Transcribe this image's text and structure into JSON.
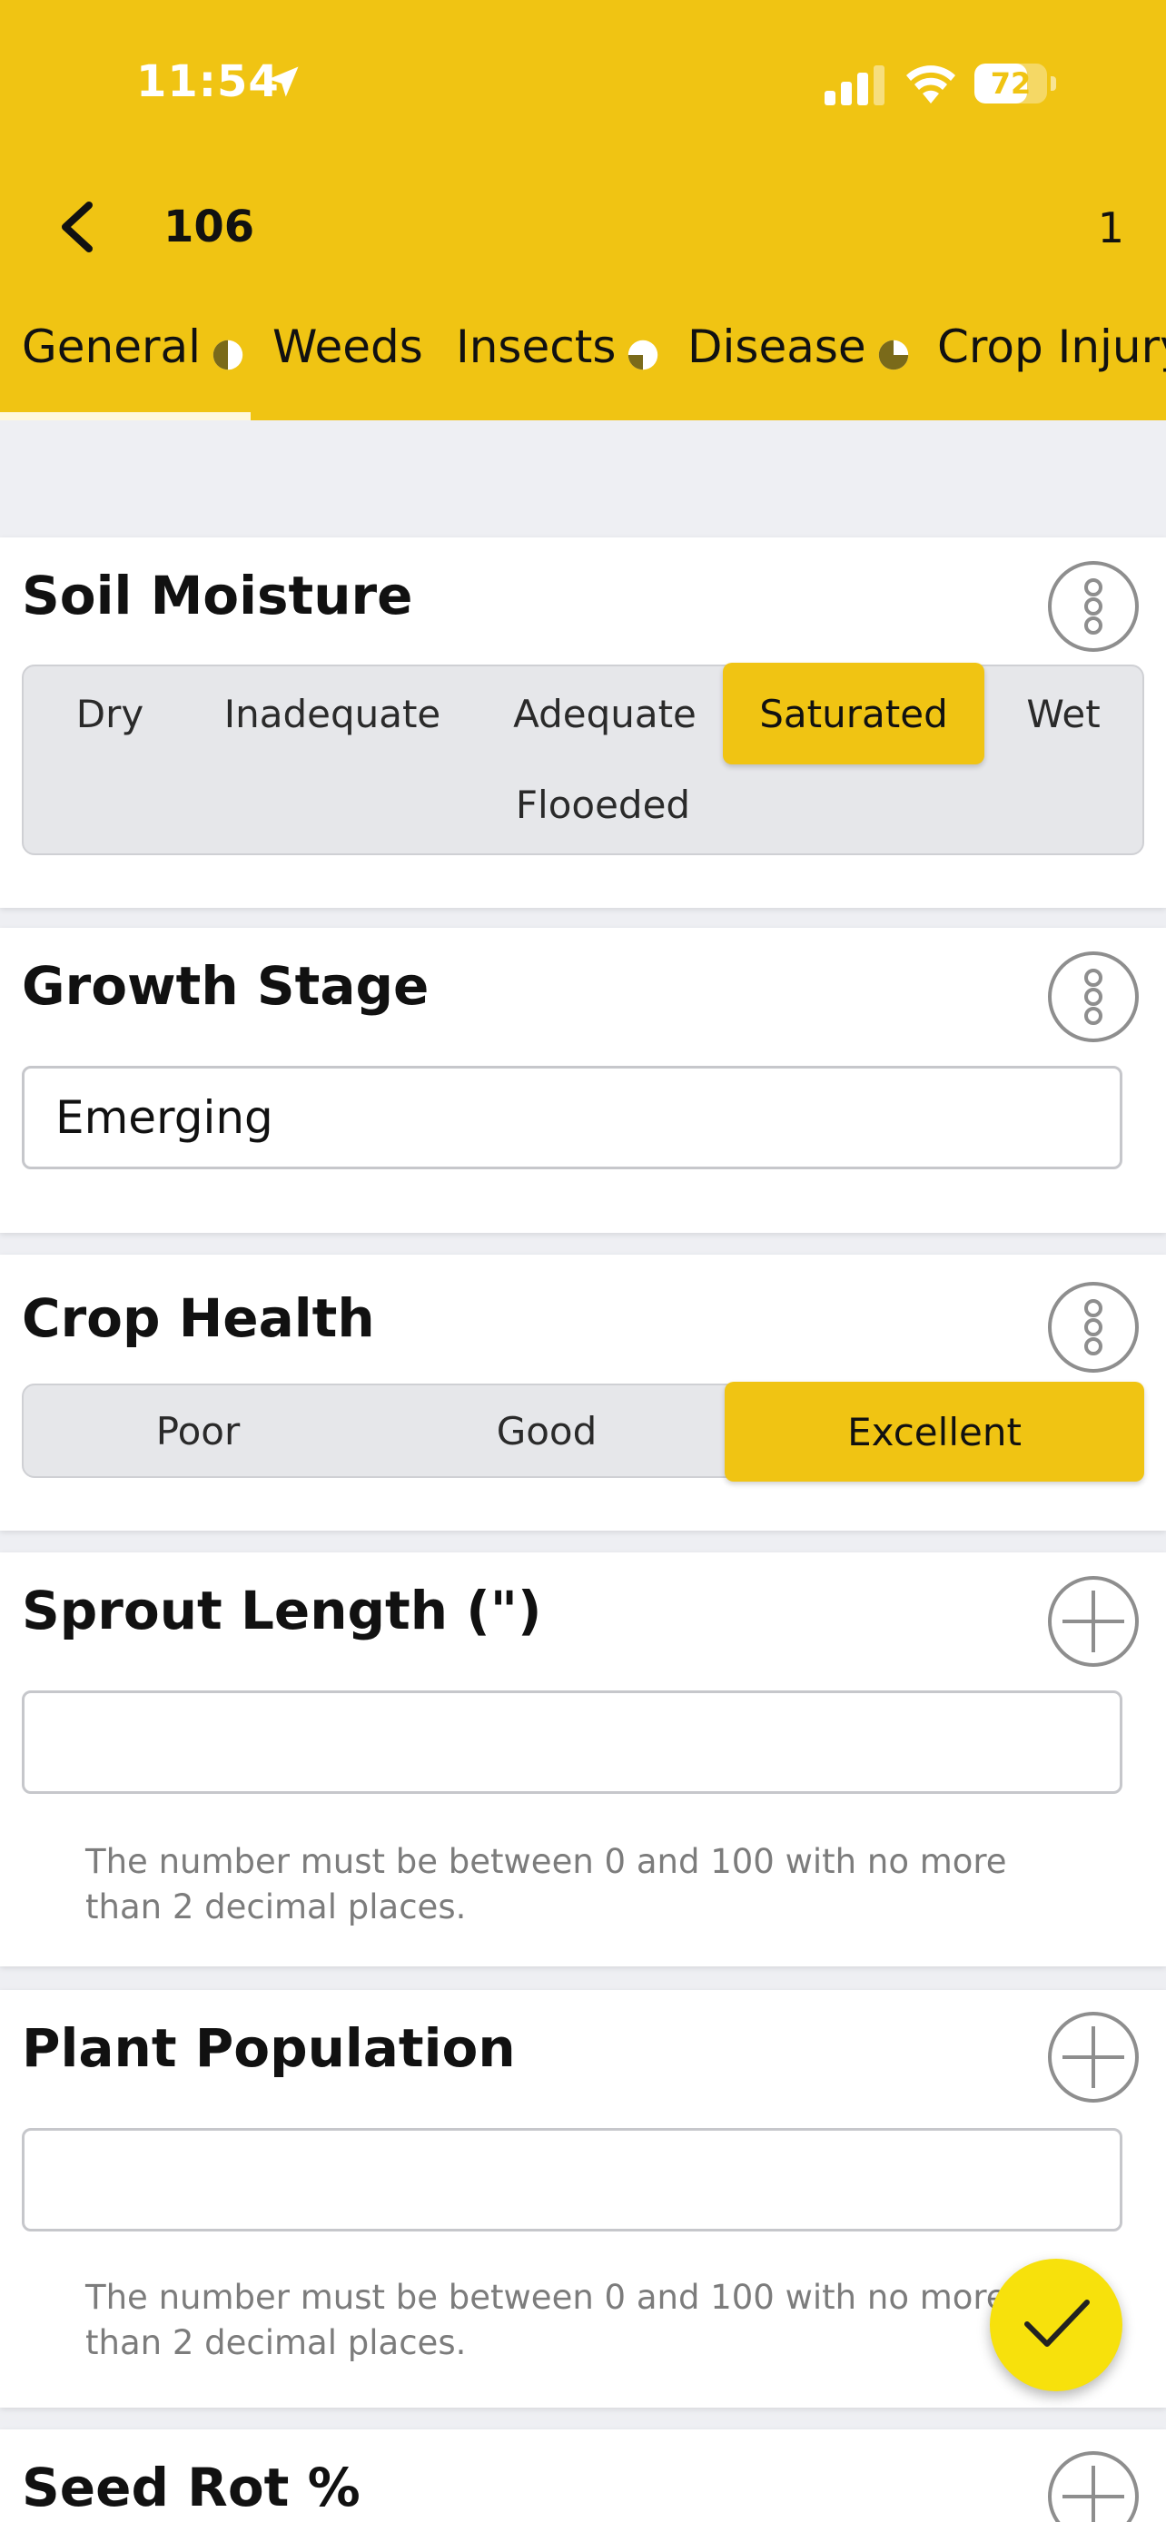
{
  "status_bar": {
    "time": "11:54",
    "battery_percent": "72",
    "battery_level": 0.72
  },
  "nav": {
    "title": "106",
    "count": "1"
  },
  "tabs": [
    {
      "label": "General",
      "indicator": "half-pie-icon"
    },
    {
      "label": "Weeds"
    },
    {
      "label": "Insects",
      "indicator": "quarter-pie-icon"
    },
    {
      "label": "Disease",
      "indicator": "three-quarter-pie-icon"
    },
    {
      "label": "Crop Injury"
    }
  ],
  "soil_moisture": {
    "title": "Soil Moisture",
    "options": [
      "Dry",
      "Inadequate",
      "Adequate",
      "Saturated",
      "Wet",
      "Flooeded"
    ],
    "selected": "Saturated"
  },
  "growth_stage": {
    "title": "Growth Stage",
    "value": "Emerging"
  },
  "crop_health": {
    "title": "Crop Health",
    "options": [
      "Poor",
      "Good",
      "Excellent"
    ],
    "selected": "Excellent"
  },
  "sprout_length": {
    "title": "Sprout Length (\")",
    "value": "",
    "hint": "The number must be between 0 and 100 with no more than 2 decimal places."
  },
  "plant_population": {
    "title": "Plant Population",
    "value": "",
    "hint": "The number must be between 0 and 100 with no more than 2 decimal places."
  },
  "seed_rot": {
    "title": "Seed Rot %"
  },
  "colors": {
    "accent": "#f0c413",
    "fab": "#f7e10c",
    "segment_bg": "#e6e7ea"
  }
}
